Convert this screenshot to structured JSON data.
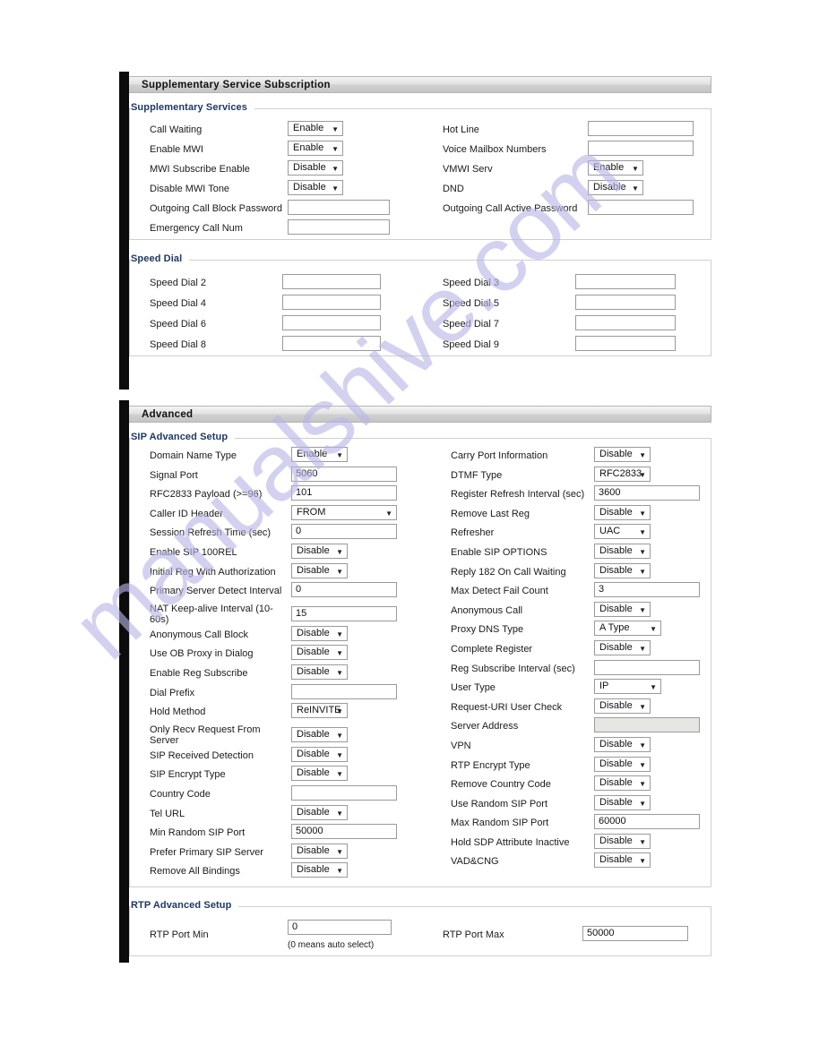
{
  "watermark": {
    "text": "manualshive.com"
  },
  "panels": [
    {
      "title": "Supplementary Service Subscription",
      "groups": [
        {
          "legend": "Supplementary Services",
          "left": [
            {
              "label": "Call Waiting",
              "control": "select",
              "value": "Enable"
            },
            {
              "label": "Enable MWI",
              "control": "select",
              "value": "Enable"
            },
            {
              "label": "MWI Subscribe Enable",
              "control": "select",
              "value": "Disable"
            },
            {
              "label": "Disable MWI Tone",
              "control": "select",
              "value": "Disable"
            },
            {
              "label": "Outgoing Call Block Password",
              "control": "text",
              "value": ""
            },
            {
              "label": "Emergency Call Num",
              "control": "text",
              "value": ""
            }
          ],
          "right": [
            {
              "label": "Hot Line",
              "control": "text",
              "value": ""
            },
            {
              "label": "Voice Mailbox Numbers",
              "control": "text",
              "value": ""
            },
            {
              "label": "VMWI Serv",
              "control": "select",
              "value": "Enable"
            },
            {
              "label": "DND",
              "control": "select",
              "value": "Disable"
            },
            {
              "label": "Outgoing Call Active Password",
              "control": "text",
              "value": ""
            }
          ]
        },
        {
          "legend": "Speed Dial",
          "left": [
            {
              "label": "Speed Dial 2",
              "control": "text",
              "value": ""
            },
            {
              "label": "Speed Dial 4",
              "control": "text",
              "value": ""
            },
            {
              "label": "Speed Dial 6",
              "control": "text",
              "value": ""
            },
            {
              "label": "Speed Dial 8",
              "control": "text",
              "value": ""
            }
          ],
          "right": [
            {
              "label": "Speed Dial 3",
              "control": "text",
              "value": ""
            },
            {
              "label": "Speed Dial 5",
              "control": "text",
              "value": ""
            },
            {
              "label": "Speed Dial 7",
              "control": "text",
              "value": ""
            },
            {
              "label": "Speed Dial 9",
              "control": "text",
              "value": ""
            }
          ]
        }
      ]
    },
    {
      "title": "Advanced",
      "groups": [
        {
          "legend": "SIP Advanced Setup",
          "left": [
            {
              "label": "Domain Name Type",
              "control": "select",
              "value": "Enable"
            },
            {
              "label": "Signal Port",
              "control": "text",
              "value": "5060"
            },
            {
              "label": "RFC2833 Payload (>=96)",
              "control": "text",
              "value": "101"
            },
            {
              "label": "Caller ID Header",
              "control": "select",
              "value": "FROM",
              "wide": true
            },
            {
              "label": "Session Refresh Time (sec)",
              "control": "text",
              "value": "0"
            },
            {
              "label": "Enable SIP 100REL",
              "control": "select",
              "value": "Disable"
            },
            {
              "label": "Initial Reg With Authorization",
              "control": "select",
              "value": "Disable"
            },
            {
              "label": "Primary Server Detect Interval",
              "control": "text",
              "value": "0"
            },
            {
              "label": "NAT Keep-alive Interval (10-60s)",
              "control": "text",
              "value": "15",
              "tall": true
            },
            {
              "label": "Anonymous Call Block",
              "control": "select",
              "value": "Disable"
            },
            {
              "label": "Use OB Proxy in Dialog",
              "control": "select",
              "value": "Disable"
            },
            {
              "label": "Enable Reg Subscribe",
              "control": "select",
              "value": "Disable"
            },
            {
              "label": "Dial Prefix",
              "control": "text",
              "value": ""
            },
            {
              "label": "Hold Method",
              "control": "select",
              "value": "ReINVITE"
            },
            {
              "label": "Only Recv Request From Server",
              "control": "select",
              "value": "Disable",
              "tall": true
            },
            {
              "label": "SIP Received Detection",
              "control": "select",
              "value": "Disable"
            },
            {
              "label": "SIP Encrypt Type",
              "control": "select",
              "value": "Disable"
            },
            {
              "label": "Country Code",
              "control": "text",
              "value": ""
            },
            {
              "label": "Tel URL",
              "control": "select",
              "value": "Disable"
            },
            {
              "label": "Min Random SIP Port",
              "control": "text",
              "value": "50000"
            },
            {
              "label": "Prefer Primary SIP Server",
              "control": "select",
              "value": "Disable"
            },
            {
              "label": "Remove All Bindings",
              "control": "select",
              "value": "Disable"
            }
          ],
          "right": [
            {
              "label": "Carry Port Information",
              "control": "select",
              "value": "Disable"
            },
            {
              "label": "DTMF Type",
              "control": "select",
              "value": "RFC2833"
            },
            {
              "label": "Register Refresh Interval (sec)",
              "control": "text",
              "value": "3600"
            },
            {
              "label": "Remove Last Reg",
              "control": "select",
              "value": "Disable"
            },
            {
              "label": "Refresher",
              "control": "select",
              "value": "UAC"
            },
            {
              "label": "Enable SIP OPTIONS",
              "control": "select",
              "value": "Disable"
            },
            {
              "label": "Reply 182 On Call Waiting",
              "control": "select",
              "value": "Disable"
            },
            {
              "label": "Max Detect Fail Count",
              "control": "text",
              "value": "3"
            },
            {
              "label": "Anonymous Call",
              "control": "select",
              "value": "Disable"
            },
            {
              "label": "Proxy DNS Type",
              "control": "select",
              "value": "A Type",
              "wide": true
            },
            {
              "label": "Complete Register",
              "control": "select",
              "value": "Disable"
            },
            {
              "label": "Reg Subscribe Interval (sec)",
              "control": "text",
              "value": ""
            },
            {
              "label": "User Type",
              "control": "select",
              "value": "IP",
              "wide": true
            },
            {
              "label": "Request-URI User Check",
              "control": "select",
              "value": "Disable"
            },
            {
              "label": "Server Address",
              "control": "text",
              "value": "",
              "disabled": true
            },
            {
              "label": "VPN",
              "control": "select",
              "value": "Disable"
            },
            {
              "label": "RTP Encrypt Type",
              "control": "select",
              "value": "Disable"
            },
            {
              "label": "Remove Country Code",
              "control": "select",
              "value": "Disable"
            },
            {
              "label": "Use Random SIP Port",
              "control": "select",
              "value": "Disable"
            },
            {
              "label": "Max Random SIP Port",
              "control": "text",
              "value": "60000"
            },
            {
              "label": "Hold SDP Attribute Inactive",
              "control": "select",
              "value": "Disable"
            },
            {
              "label": "VAD&CNG",
              "control": "select",
              "value": "Disable"
            }
          ]
        },
        {
          "legend": "RTP Advanced Setup",
          "left": [
            {
              "label": "RTP Port Min",
              "control": "text",
              "value": "0",
              "hint": "(0 means auto select)"
            }
          ],
          "right": [
            {
              "label": "RTP Port Max",
              "control": "text",
              "value": "50000"
            }
          ]
        }
      ]
    }
  ]
}
